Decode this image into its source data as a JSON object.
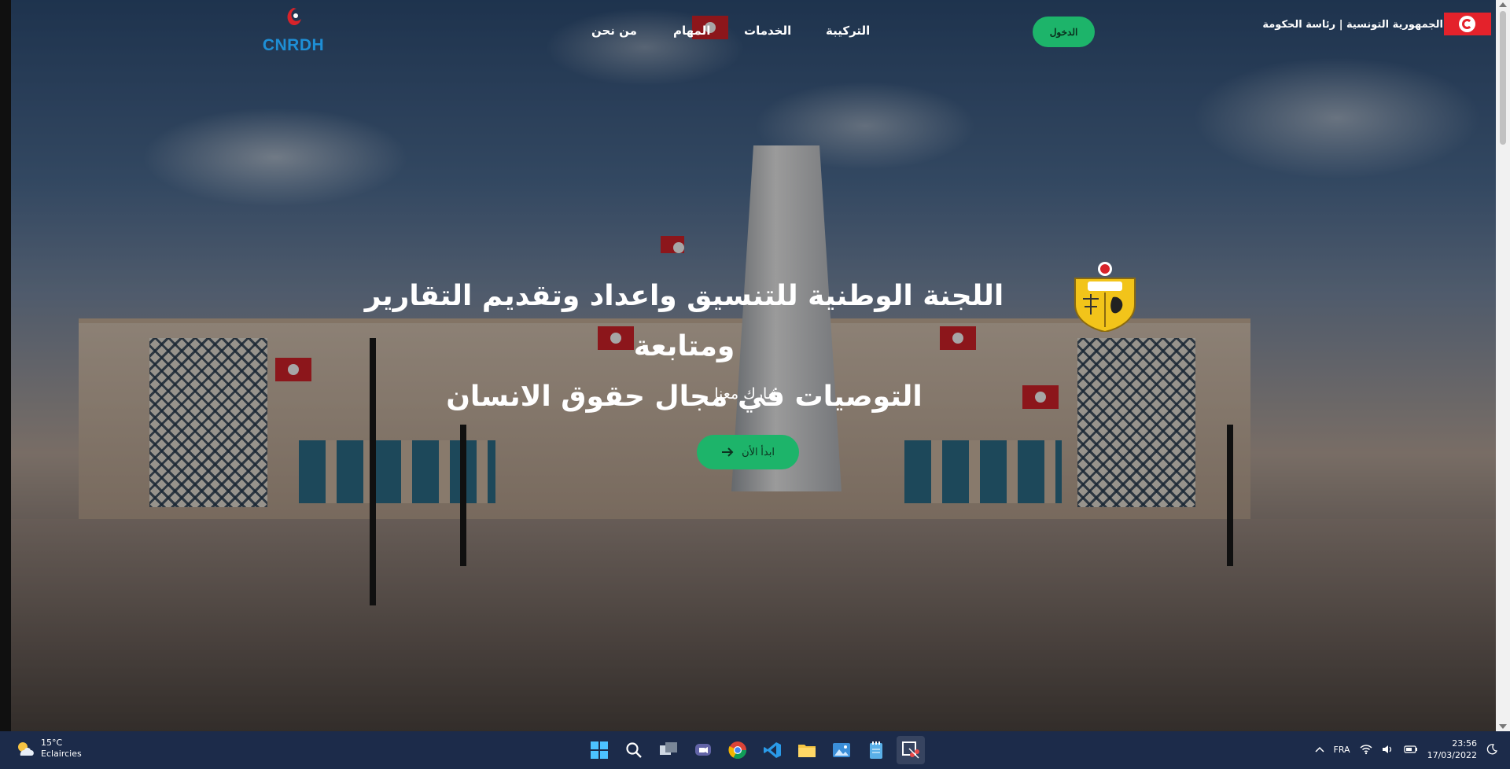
{
  "header": {
    "logo_text": "CNRDH",
    "nav": [
      "من نحن",
      "المهام",
      "الخدمات",
      "التركيبة"
    ],
    "login_label": "الدخول",
    "gov_label": "الجمهورية التونسية | رئاسة الحكومة"
  },
  "hero": {
    "title_line1": "اللجنة الوطنية للتنسيق واعداد وتقديم التقارير ومتابعة",
    "title_line2": "التوصيات في مجال حقوق الانسان",
    "subtitle": "شارك معنا",
    "cta_label": "ابدأ الأن"
  },
  "taskbar": {
    "temperature": "15°C",
    "weather_desc": "Eclaircies",
    "language": "FRA",
    "time": "23:56",
    "date": "17/03/2022",
    "apps": [
      "start-icon",
      "search-icon",
      "task-view-icon",
      "chat-icon",
      "chrome-icon",
      "vscode-icon",
      "file-explorer-icon",
      "photos-icon",
      "notepad-icon",
      "snipping-tool-icon"
    ]
  },
  "colors": {
    "accent_green": "#1db46a",
    "logo_blue": "#1e8fd6",
    "taskbar": "#1c2b4a"
  }
}
